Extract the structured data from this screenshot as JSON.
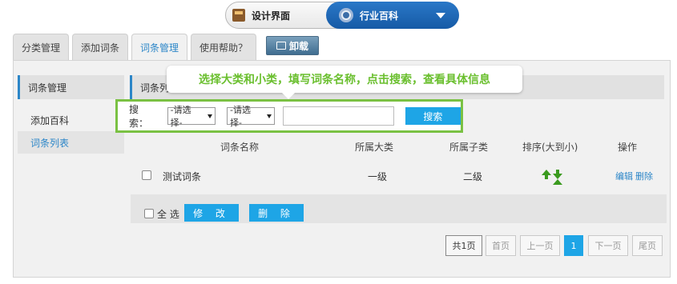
{
  "top_switch": {
    "left_label": "设计界面",
    "left_icon": "design-icon",
    "right_label": "行业百科",
    "right_icon": "gear-icon",
    "accent": "#1a62b2"
  },
  "tabs": [
    {
      "label": "分类管理"
    },
    {
      "label": "添加词条"
    },
    {
      "label": "词条管理",
      "active": true
    },
    {
      "label": "使用帮助？"
    }
  ],
  "unload_button": {
    "label": "卸载"
  },
  "sidebar": {
    "title": "词条管理",
    "items": [
      {
        "label": "添加百科"
      },
      {
        "label": "词条列表",
        "active": true
      }
    ]
  },
  "content_header": {
    "title": "词条列"
  },
  "tooltip": {
    "text": "选择大类和小类，填写词条名称，点击搜索，查看具体信息",
    "color": "#6abf2e"
  },
  "search": {
    "label": "搜索：",
    "category_select": "-请选择-",
    "subcategory_select": "-请选择-",
    "keyword_value": "",
    "button_label": "搜索"
  },
  "table": {
    "columns": [
      "词条名称",
      "所属大类",
      "所属子类",
      "排序(大到小)",
      "操作"
    ],
    "rows": [
      {
        "name": "测试词条",
        "category": "一级",
        "subcategory": "二级",
        "actions": [
          "编辑",
          "删除"
        ]
      }
    ]
  },
  "bulk": {
    "select_all": "全 选",
    "edit_button": "修 改",
    "delete_button": "删 除"
  },
  "pagination": {
    "total": "共1页",
    "first": "首页",
    "prev": "上一页",
    "current": "1",
    "next": "下一页",
    "last": "尾页"
  }
}
